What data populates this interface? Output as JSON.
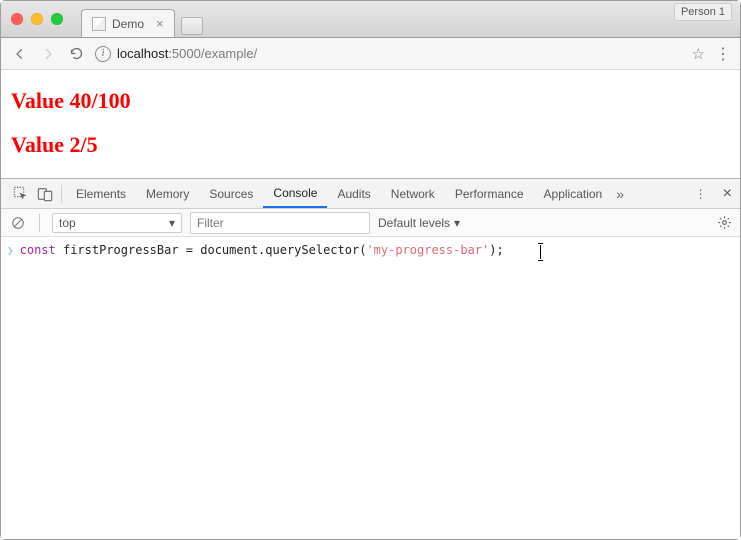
{
  "window": {
    "tab_title": "Demo",
    "profile_label": "Person 1"
  },
  "toolbar": {
    "url_host": "localhost",
    "url_port": ":5000",
    "url_path": "/example/"
  },
  "page": {
    "line1": "Value 40/100",
    "line2": "Value 2/5"
  },
  "devtools": {
    "tabs": {
      "elements": "Elements",
      "memory": "Memory",
      "sources": "Sources",
      "console": "Console",
      "audits": "Audits",
      "network": "Network",
      "performance": "Performance",
      "application": "Application"
    },
    "sub": {
      "context": "top",
      "filter_placeholder": "Filter",
      "levels_label": "Default levels"
    },
    "console": {
      "tok_kw": "const",
      "tok_var": " firstProgressBar ",
      "tok_eq": "= ",
      "tok_obj": "document",
      "tok_dot": ".",
      "tok_fn": "querySelector",
      "tok_open": "(",
      "tok_str": "'my-progress-bar'",
      "tok_close": ");"
    }
  }
}
